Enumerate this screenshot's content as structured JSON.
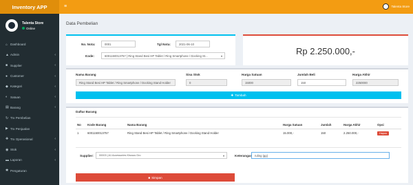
{
  "app": {
    "title": "Inventory APP"
  },
  "topbar": {
    "user": "Talenta Store"
  },
  "user": {
    "name": "Talenta Store",
    "status": "Online"
  },
  "sidebar": {
    "items": [
      {
        "label": "Dashboard",
        "icon": "dashboard-icon",
        "glyph": "⌂",
        "has_children": false
      },
      {
        "label": "Admin",
        "icon": "user-icon",
        "glyph": "▲",
        "has_children": true
      },
      {
        "label": "Supplier",
        "icon": "truck-icon",
        "glyph": "■",
        "has_children": true
      },
      {
        "label": "Customer",
        "icon": "users-icon",
        "glyph": "●",
        "has_children": true
      },
      {
        "label": "Kategori",
        "icon": "tag-icon",
        "glyph": "◆",
        "has_children": true
      },
      {
        "label": "Satuan",
        "icon": "scale-icon",
        "glyph": "◐",
        "has_children": true
      },
      {
        "label": "Barang",
        "icon": "box-icon",
        "glyph": "▤",
        "has_children": true
      },
      {
        "label": "Trx Pembelian",
        "icon": "cart-icon",
        "glyph": "↻",
        "has_children": false
      },
      {
        "label": "Trx Penjualan",
        "icon": "money-icon",
        "glyph": "▶",
        "has_children": false
      },
      {
        "label": "Trx Operasional",
        "icon": "cog-icon",
        "glyph": "✚",
        "has_children": true
      },
      {
        "label": "Stok",
        "icon": "stock-icon",
        "glyph": "◉",
        "has_children": true
      },
      {
        "label": "Laporan",
        "icon": "report-icon",
        "glyph": "▬",
        "has_children": true
      },
      {
        "label": "Pengaturan",
        "icon": "gear-icon",
        "glyph": "✱",
        "has_children": false
      }
    ]
  },
  "page": {
    "title": "Data Pembelian"
  },
  "form": {
    "no_nota_label": "No. Nota:",
    "no_nota": "0001",
    "tgl_nota_label": "Tgl Nota:",
    "tgl_nota": "2021-06-10",
    "kode_label": "Kode:",
    "kode": "6001150013757 | Ring Stand Besi HP Tablet / Ring Smartphone / Docking St..."
  },
  "total": "Rp 2.250.000,-",
  "item": {
    "nama_label": "Nama Barang",
    "nama": "Ring Stand Besi HP Tablet / Ring Smartphone / Docking Stand Holder",
    "sisa_label": "Sisa Stok",
    "sisa": "0",
    "harga_label": "Harga Satuan",
    "harga": "15000",
    "jumlah_label": "Jumlah Beli",
    "jumlah": "150",
    "akhir_label": "Harga Akhir",
    "akhir": "2250000",
    "tambah": "Tambah"
  },
  "detail": {
    "title": "Daftar Barang",
    "columns": [
      "No",
      "Kode Barang",
      "Nama Barang",
      "Harga Satuan",
      "Jumlah",
      "Harga Akhir",
      "Opsi"
    ],
    "rows": [
      [
        "1",
        "6001150013757",
        "Ring Stand Besi HP Tablet / Ring Smartphone / Docking Stand Holder",
        "15.000,-",
        "150",
        "2.250.000,-",
        "Hapus"
      ]
    ],
    "supplier_label": "Supplier:",
    "supplier": "00003 | A1 Accessories Khusus Gro",
    "keterangan_label": "Keterangan:",
    "keterangan": "ruling |gg|",
    "simpan": "Simpan"
  },
  "colors": {
    "topbar": "#f39c12",
    "sidebar": "#222d32",
    "info": "#00c0ef",
    "danger": "#dd4b39"
  }
}
